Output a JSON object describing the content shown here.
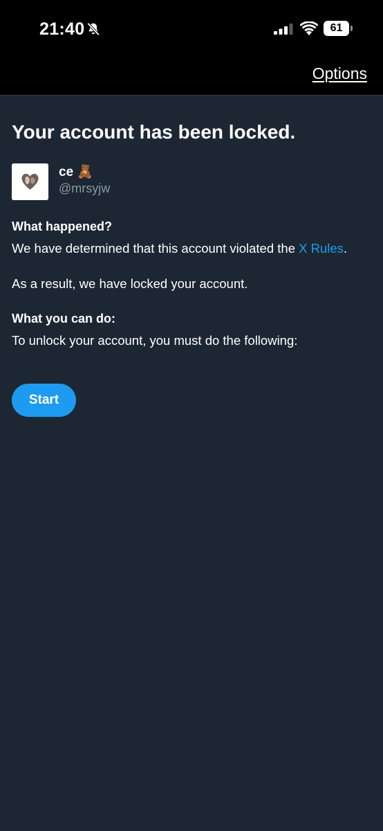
{
  "status_bar": {
    "time": "21:40",
    "battery": "61",
    "icons": [
      "bell-slash-icon",
      "signal-icon",
      "wifi-icon",
      "battery-icon"
    ]
  },
  "header": {
    "options_label": "Options"
  },
  "main": {
    "title": "Your account has been locked.",
    "user": {
      "name": "ce",
      "emoji": "🧸",
      "handle": "@mrsyjw"
    },
    "what_happened": {
      "heading": "What happened?",
      "text_before_link": "We have determined that this account violated the ",
      "link_text": "X Rules",
      "text_after_link": "."
    },
    "result_text": "As a result, we have locked your account.",
    "what_you_can_do": {
      "heading": "What you can do:",
      "text": "To unlock your account, you must do the following:"
    },
    "start_label": "Start"
  },
  "colors": {
    "background": "#1c2733",
    "accent": "#1d9bf0",
    "muted_text": "#8b98a5"
  }
}
